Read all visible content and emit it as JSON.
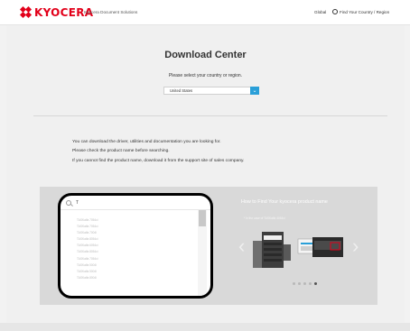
{
  "header": {
    "logo_text": "KYOCERA",
    "tagline": "Kyocera Document Solutions",
    "global_label": "Global",
    "region_label": "Find Your Country / Region"
  },
  "main": {
    "title": "Download Center",
    "country_prompt": "Please select your country or region.",
    "country_value": "United States",
    "info_lines": [
      "You can download the driver, utilities and documentation you are looking for.",
      "Please check the product name before searching.",
      "If you cannot find the product name, download it from the support site of sales company."
    ]
  },
  "search": {
    "query": "T",
    "suggestions": [
      "TASKalfa 7054ci",
      "TASKalfa 7054ci",
      "TASKalfa 7004i",
      "TASKalfa 8054ci",
      "TASKalfa 6054ci",
      "TASKalfa 8054ci",
      "TASKalfa 7054ci",
      "TASKalfa 5004i",
      "TASKalfa 5004i",
      "TASKalfa 8004i"
    ]
  },
  "promo": {
    "title": "How to Find Your kyocera product name",
    "caption": "* In the case of TASKalfa 4054ci"
  },
  "colors": {
    "brand_red": "#e2001a",
    "accent_blue": "#2a9fd8"
  }
}
